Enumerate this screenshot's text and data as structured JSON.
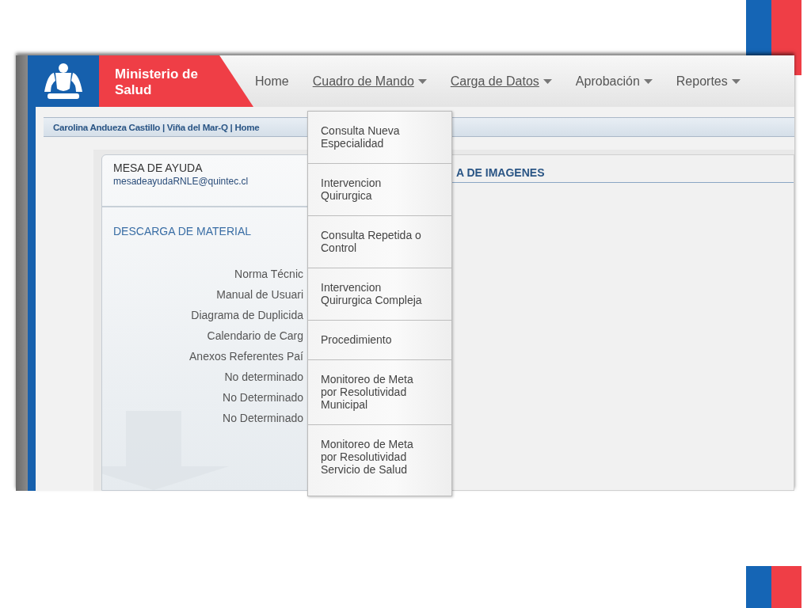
{
  "header": {
    "brand": "Ministerio de Salud",
    "nav": [
      {
        "label": "Home",
        "underlined": false,
        "has_menu": false
      },
      {
        "label": "Cuadro de Mando",
        "underlined": true,
        "has_menu": true
      },
      {
        "label": "Carga de Datos",
        "underlined": true,
        "has_menu": true
      },
      {
        "label": "Aprobación",
        "underlined": false,
        "has_menu": true
      },
      {
        "label": "Reportes",
        "underlined": false,
        "has_menu": true
      }
    ]
  },
  "breadcrumb": "Carolina Andueza Castillo | Viña del Mar-Q | Home",
  "help_panel": {
    "title": "MESA DE AYUDA",
    "email": "mesadeayudaRNLE@quintec.cl"
  },
  "downloads": {
    "title": "DESCARGA DE MATERIAL",
    "items": [
      "Norma Técnic",
      "Manual de Usuari",
      "Diagrama de Duplicida",
      "Calendario de Carg",
      "Anexos Referentes Paí",
      "No determinado",
      "No Determinado",
      "No Determinado"
    ]
  },
  "right_panel": {
    "title": "A DE IMAGENES"
  },
  "dropdown": {
    "items": [
      {
        "label": "Consulta Nueva\nEspecialidad"
      },
      {
        "label": "Intervencion\nQuirurgica"
      },
      {
        "label": "Consulta Repetida o\nControl"
      },
      {
        "label": "Intervencion\nQuirurgica Compleja"
      },
      {
        "label": "Procedimiento"
      },
      {
        "label": "Monitoreo de Meta\npor Resolutividad\nMunicipal"
      },
      {
        "label": "Monitoreo de Meta\npor Resolutividad\nServicio de Salud"
      }
    ]
  }
}
